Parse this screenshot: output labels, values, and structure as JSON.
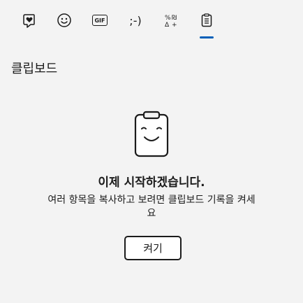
{
  "tabs": [
    {
      "icon": "kaomoji-heart-icon",
      "selected": false
    },
    {
      "icon": "emoji-smiley-icon",
      "selected": false
    },
    {
      "icon": "gif-icon",
      "label": "GIF",
      "selected": false
    },
    {
      "icon": "kaomoji-icon",
      "label": ";-)",
      "selected": false
    },
    {
      "icon": "symbols-icon",
      "selected": false
    },
    {
      "icon": "clipboard-icon",
      "selected": true
    }
  ],
  "section": {
    "title": "클립보드"
  },
  "empty_state": {
    "illustration": "clipboard-smiley-icon",
    "headline": "이제 시작하겠습니다.",
    "description": "여러 항목을 복사하고 보려면 클립보드 기록을 켜세요"
  },
  "actions": {
    "turn_on_label": "켜기"
  },
  "colors": {
    "accent": "#005fb8",
    "background": "#f3f3f3"
  }
}
